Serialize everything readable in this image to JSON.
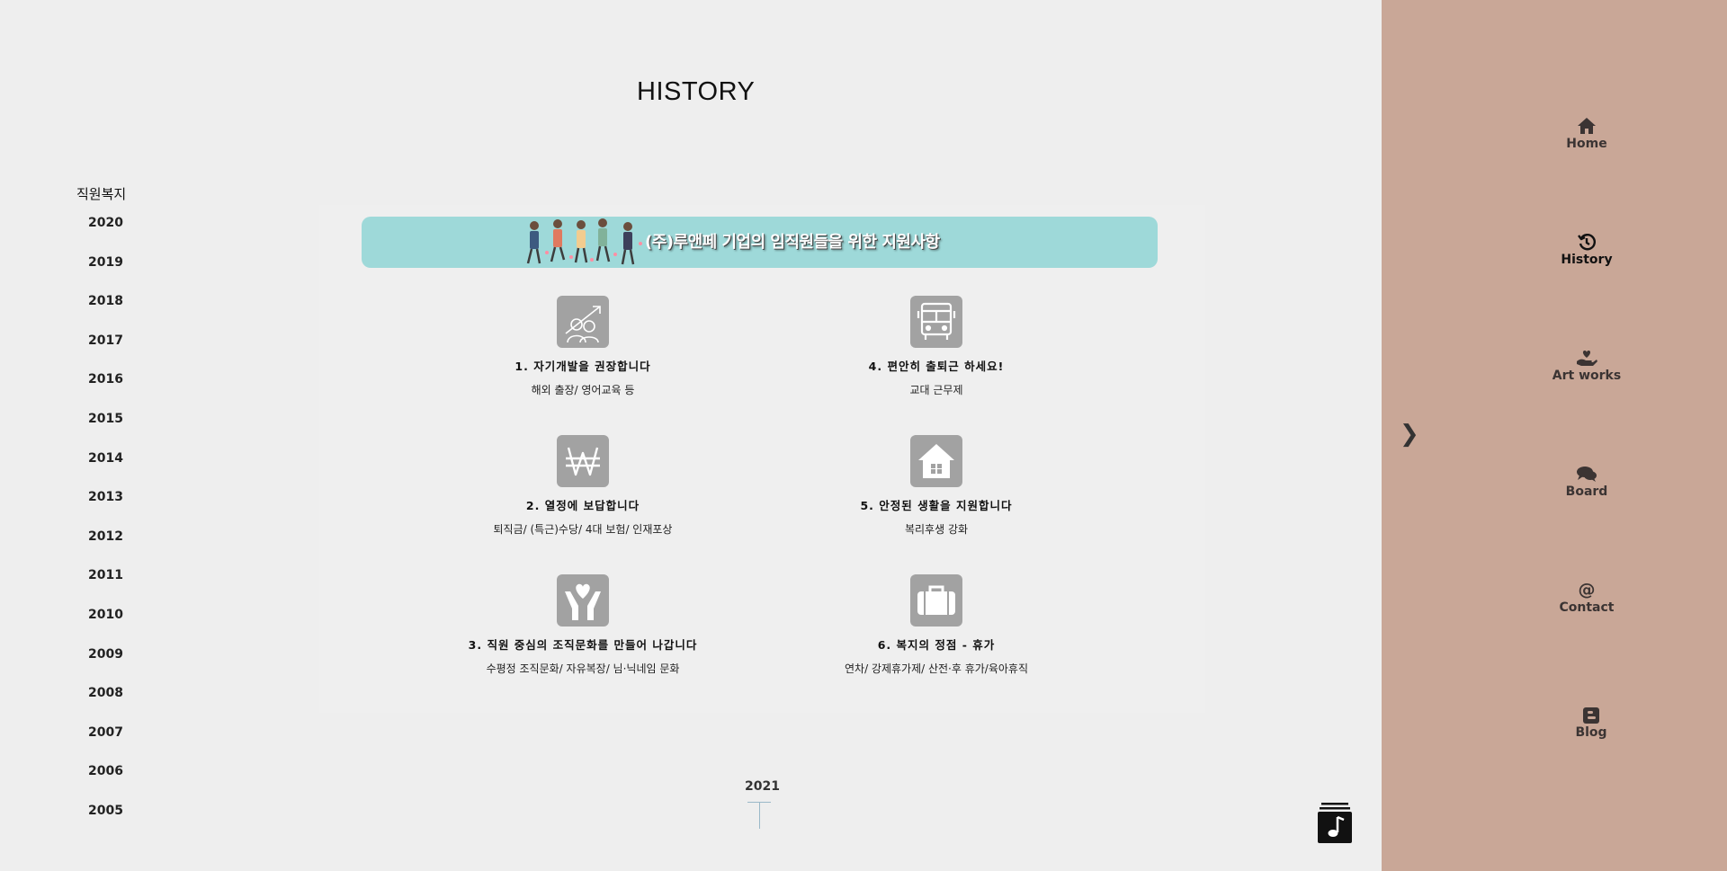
{
  "page": {
    "title": "HISTORY"
  },
  "year_nav": {
    "heading": "직원복지",
    "years": [
      "2020",
      "2019",
      "2018",
      "2017",
      "2016",
      "2015",
      "2014",
      "2013",
      "2012",
      "2011",
      "2010",
      "2009",
      "2008",
      "2007",
      "2006",
      "2005"
    ]
  },
  "banner": {
    "text": "(주)루앤페 기업의 임직원들을 위한 지원사항"
  },
  "benefits": [
    {
      "title": "1. 자기개발을 권장합니다",
      "desc": "해외 출장/ 영어교육 등",
      "icon": "growth-chart-icon"
    },
    {
      "title": "2. 열정에 보답합니다",
      "desc": "퇴직금/ (특근)수당/ 4대 보험/ 인재포상",
      "icon": "won-currency-icon"
    },
    {
      "title": "3. 직원 중심의 조직문화를 만들어 나갑니다",
      "desc": "수평정 조직문화/ 자유복장/ 님·닉네임 문화",
      "icon": "hands-heart-icon"
    },
    {
      "title": "4. 편안히 출퇴근 하세요!",
      "desc": "교대 근무제",
      "icon": "bus-icon"
    },
    {
      "title": "5. 안정된 생활을 지원합니다",
      "desc": "복리후생 강화",
      "icon": "house-icon"
    },
    {
      "title": "6. 복지의 정점 - 휴가",
      "desc": "연차/ 강제휴가제/ 산전·후 휴가/육아휴직",
      "icon": "suitcase-icon"
    }
  ],
  "timeline": {
    "year": "2021"
  },
  "sidebar": {
    "toggle": "❯",
    "items": [
      {
        "label": "Home",
        "icon": "home-icon"
      },
      {
        "label": "History",
        "icon": "history-icon",
        "active": true
      },
      {
        "label": "Art works",
        "icon": "hand-heart-icon"
      },
      {
        "label": "Board",
        "icon": "comments-icon"
      },
      {
        "label": "Contact",
        "icon": "at-icon"
      },
      {
        "label": "Blog",
        "icon": "blogger-icon"
      }
    ]
  },
  "colors": {
    "background": "#eeeeee",
    "sidebar": "#c9a797",
    "banner": "#9ed9d9",
    "icon_box": "#a2a2a2"
  }
}
